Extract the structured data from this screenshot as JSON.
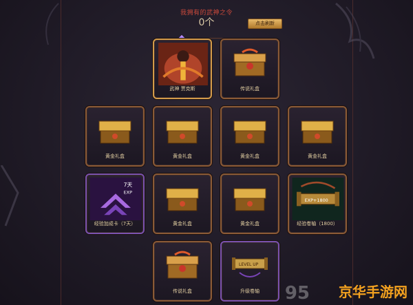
{
  "header": {
    "label": "我拥有的武神之令",
    "count": "0个",
    "refresh_label": "点击刷新"
  },
  "rows": [
    [
      {
        "label": "武神 贾克斯",
        "art": "hero"
      },
      {
        "label": "传说礼盒",
        "art": "legend-box"
      }
    ],
    [
      {
        "label": "黄金礼盒",
        "art": "gold-box"
      },
      {
        "label": "黄金礼盒",
        "art": "gold-box"
      },
      {
        "label": "黄金礼盒",
        "art": "gold-box"
      },
      {
        "label": "黄金礼盒",
        "art": "gold-box"
      }
    ],
    [
      {
        "label": "经验加成卡（7天）",
        "art": "exp-card",
        "badge": "7天",
        "tag": "EXP"
      },
      {
        "label": "黄金礼盒",
        "art": "gold-box"
      },
      {
        "label": "黄金礼盒",
        "art": "gold-box"
      },
      {
        "label": "经验卷轴（1800）",
        "art": "exp-scroll",
        "badge": "EXP+1800"
      }
    ],
    [
      {
        "label": "传说礼盒",
        "art": "legend-box"
      },
      {
        "label": "升级卷轴",
        "art": "levelup-scroll",
        "badge": "LEVEL UP"
      }
    ]
  ],
  "watermark": {
    "number": "95",
    "text": "京华手游网"
  }
}
